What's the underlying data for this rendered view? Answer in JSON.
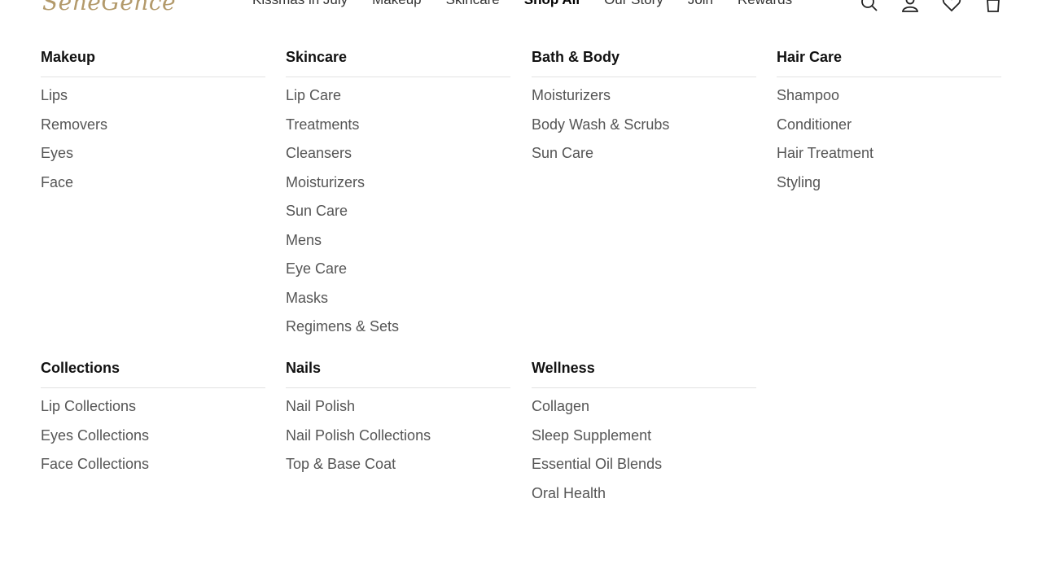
{
  "header": {
    "logo_text": "SeneGence",
    "nav": [
      "Kissmas in July",
      "Makeup",
      "Skincare",
      "Shop All",
      "Our Story",
      "Join",
      "Rewards"
    ],
    "active_nav": "Shop All",
    "icons": [
      "search-icon",
      "account-icon",
      "heart-icon",
      "cart-icon"
    ]
  },
  "menu": {
    "columns": [
      {
        "title": "Makeup",
        "items": [
          "Lips",
          "Removers",
          "Eyes",
          "Face"
        ]
      },
      {
        "title": "Skincare",
        "items": [
          "Lip Care",
          "Treatments",
          "Cleansers",
          "Moisturizers",
          "Sun Care",
          "Mens",
          "Eye Care",
          "Masks",
          "Regimens & Sets"
        ]
      },
      {
        "title": "Bath & Body",
        "items": [
          "Moisturizers",
          "Body Wash & Scrubs",
          "Sun Care"
        ]
      },
      {
        "title": "Hair Care",
        "items": [
          "Shampoo",
          "Conditioner",
          "Hair Treatment",
          "Styling"
        ]
      },
      {
        "title": "Collections",
        "items": [
          "Lip Collections",
          "Eyes Collections",
          "Face Collections"
        ]
      },
      {
        "title": "Nails",
        "items": [
          "Nail Polish",
          "Nail Polish Collections",
          "Top & Base Coat"
        ]
      },
      {
        "title": "Wellness",
        "items": [
          "Collagen",
          "Sleep Supplement",
          "Essential Oil Blends",
          "Oral Health"
        ]
      }
    ]
  },
  "colors": {
    "brand_gold": "#b39a6b",
    "text": "#333333",
    "link": "#555555",
    "divider": "#e2e2e2"
  }
}
